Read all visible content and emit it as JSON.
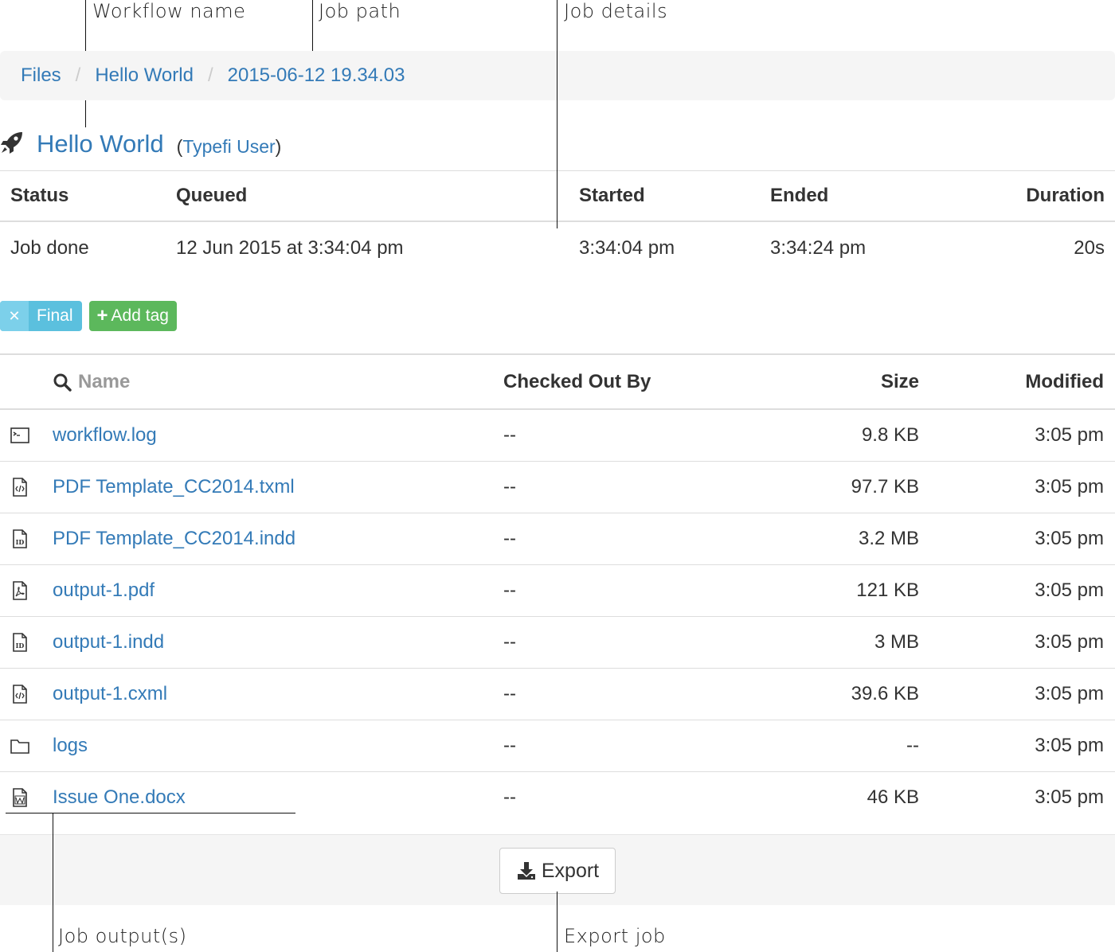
{
  "callouts": {
    "workflow_name": "Workflow name",
    "job_path": "Job path",
    "job_details": "Job details",
    "job_outputs": "Job output(s)",
    "export_job": "Export job"
  },
  "breadcrumb": {
    "items": [
      {
        "label": "Files"
      },
      {
        "label": "Hello World"
      },
      {
        "label": "2015-06-12 19.34.03"
      }
    ],
    "separator": "/"
  },
  "job": {
    "title": "Hello World",
    "user": "Typefi User",
    "icon": "rocket-icon"
  },
  "details": {
    "headers": {
      "status": "Status",
      "queued": "Queued",
      "started": "Started",
      "ended": "Ended",
      "duration": "Duration"
    },
    "values": {
      "status": "Job done",
      "queued": "12 Jun 2015 at 3:34:04 pm",
      "started": "3:34:04 pm",
      "ended": "3:34:24 pm",
      "duration": "20s"
    }
  },
  "tags": {
    "items": [
      {
        "label": "Final",
        "remove_icon": "close-icon",
        "color": "#5bc0de"
      }
    ],
    "add_label": "Add tag",
    "add_color": "#5cb85c"
  },
  "files": {
    "headers": {
      "name": "Name",
      "checked_out_by": "Checked Out By",
      "size": "Size",
      "modified": "Modified"
    },
    "rows": [
      {
        "icon": "terminal-file-icon",
        "name": "workflow.log",
        "checked_out_by": "--",
        "size": "9.8 KB",
        "modified": "3:05 pm"
      },
      {
        "icon": "code-file-icon",
        "name": "PDF Template_CC2014.txml",
        "checked_out_by": "--",
        "size": "97.7 KB",
        "modified": "3:05 pm"
      },
      {
        "icon": "indesign-file-icon",
        "name": "PDF Template_CC2014.indd",
        "checked_out_by": "--",
        "size": "3.2 MB",
        "modified": "3:05 pm"
      },
      {
        "icon": "pdf-file-icon",
        "name": "output-1.pdf",
        "checked_out_by": "--",
        "size": "121 KB",
        "modified": "3:05 pm"
      },
      {
        "icon": "indesign-file-icon",
        "name": "output-1.indd",
        "checked_out_by": "--",
        "size": "3 MB",
        "modified": "3:05 pm"
      },
      {
        "icon": "code-file-icon",
        "name": "output-1.cxml",
        "checked_out_by": "--",
        "size": "39.6 KB",
        "modified": "3:05 pm"
      },
      {
        "icon": "folder-icon",
        "name": "logs",
        "checked_out_by": "--",
        "size": "--",
        "modified": "3:05 pm"
      },
      {
        "icon": "word-file-icon",
        "name": "Issue One.docx",
        "checked_out_by": "--",
        "size": "46 KB",
        "modified": "3:05 pm"
      }
    ]
  },
  "export": {
    "label": "Export",
    "icon": "download-icon"
  },
  "colors": {
    "link": "#337ab7",
    "tag_info": "#5bc0de",
    "tag_success": "#5cb85c",
    "panel": "#f5f5f5"
  }
}
